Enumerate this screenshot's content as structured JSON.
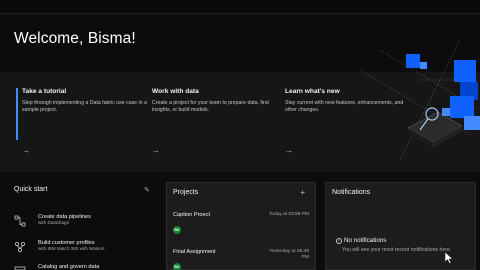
{
  "header": {
    "welcome": "Welcome, Bisma!"
  },
  "hero_cards": [
    {
      "title": "Take a tutorial",
      "desc": "Step through implementing a Data fabric use case in a sample project.",
      "arrow": "→"
    },
    {
      "title": "Work with data",
      "desc": "Create a project for your team to prepare data, find insights, or build models.",
      "arrow": "→"
    },
    {
      "title": "Learn what's new",
      "desc": "Stay current with new features, enhancements, and other changes.",
      "arrow": "→"
    }
  ],
  "quick_start": {
    "title": "Quick start",
    "edit_icon": "pencil-icon",
    "items": [
      {
        "label": "Create data pipelines",
        "sub": "with DataStage",
        "icon": "pipeline-icon"
      },
      {
        "label": "Build customer profiles",
        "sub": "with IBM Match 360 with Watson",
        "icon": "profile-icon"
      },
      {
        "label": "Catalog and govern data",
        "sub": "",
        "icon": "catalog-icon"
      }
    ]
  },
  "projects": {
    "title": "Projects",
    "add": "+",
    "items": [
      {
        "name": "Caption Proect",
        "date": "Today at 03:58 PM",
        "badge": "BK"
      },
      {
        "name": "Final Assignment",
        "date": "Yesterday at 05:49 PM",
        "badge": "BK"
      }
    ]
  },
  "notifications": {
    "title": "Notifications",
    "empty": "No notifications",
    "empty_icon": "info-icon",
    "empty_sub": "You will see your most recent notifications here."
  },
  "colors": {
    "accent": "#4589ff",
    "cube": "#0f62fe",
    "badge": "#198038"
  }
}
